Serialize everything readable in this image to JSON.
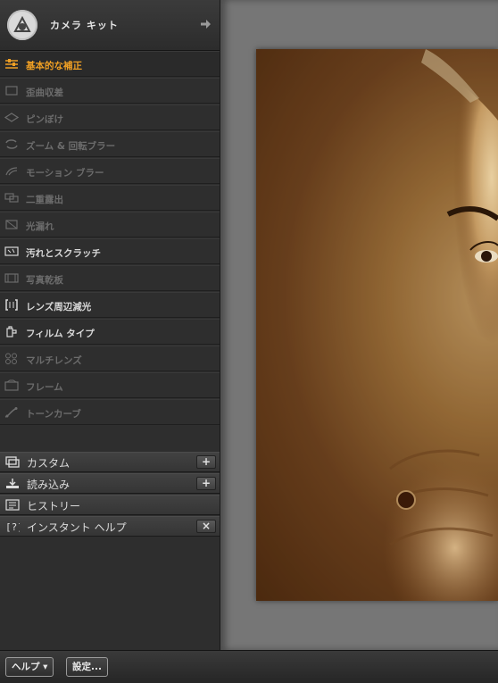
{
  "app": {
    "title": "カメラ キット"
  },
  "tools": [
    {
      "label": "基本的な補正",
      "state": "active"
    },
    {
      "label": "歪曲収差",
      "state": "off"
    },
    {
      "label": "ピンぼけ",
      "state": "off"
    },
    {
      "label": "ズーム & 回転ブラー",
      "state": "off"
    },
    {
      "label": "モーション ブラー",
      "state": "off"
    },
    {
      "label": "二重露出",
      "state": "off"
    },
    {
      "label": "光漏れ",
      "state": "off"
    },
    {
      "label": "汚れとスクラッチ",
      "state": "on"
    },
    {
      "label": "写真乾板",
      "state": "off"
    },
    {
      "label": "レンズ周辺減光",
      "state": "on"
    },
    {
      "label": "フィルム タイプ",
      "state": "on"
    },
    {
      "label": "マルチレンズ",
      "state": "off"
    },
    {
      "label": "フレーム",
      "state": "off"
    },
    {
      "label": "トーンカーブ",
      "state": "off"
    }
  ],
  "sections": [
    {
      "label": "カスタム",
      "button": "+"
    },
    {
      "label": "読み込み",
      "button": "+"
    },
    {
      "label": "ヒストリー",
      "button": ""
    },
    {
      "label": "インスタント ヘルプ",
      "button": "×"
    }
  ],
  "bottom": {
    "help_label": "ヘルプ ▾",
    "settings_label": "設定..."
  },
  "colors": {
    "accent": "#f0a024",
    "panel": "#2e2e2e",
    "canvas": "#767676"
  }
}
